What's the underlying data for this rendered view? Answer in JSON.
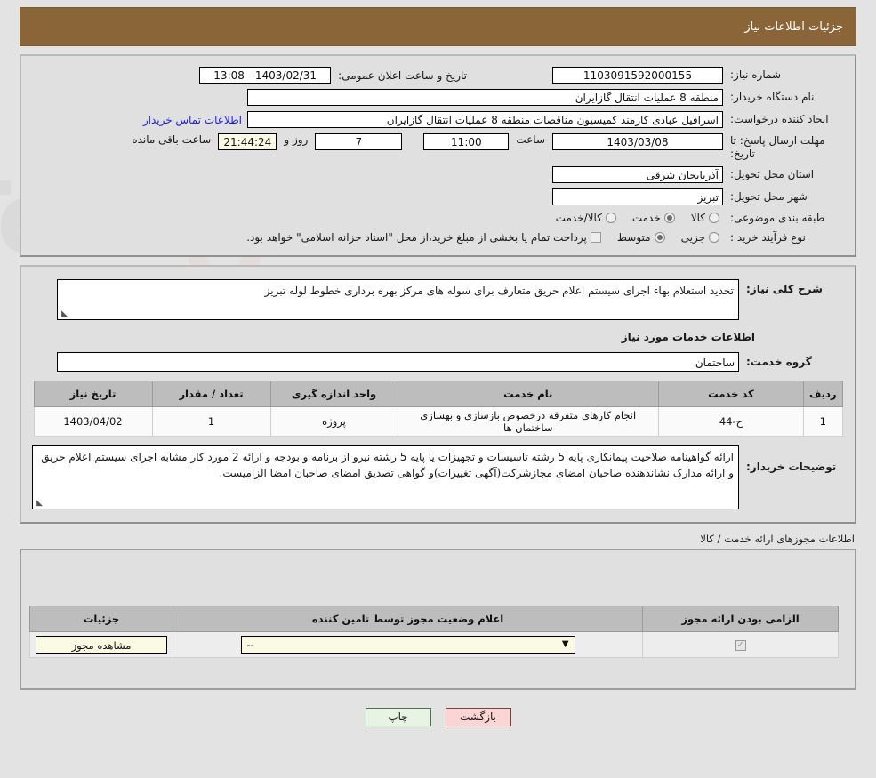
{
  "header": {
    "title": "جزئیات اطلاعات نیاز"
  },
  "fields": {
    "need_number_label": "شماره نیاز:",
    "need_number_value": "1103091592000155",
    "public_announce_label": "تاریخ و ساعت اعلان عمومی:",
    "public_announce_value": "1403/02/31 - 13:08",
    "buyer_org_label": "نام دستگاه خریدار:",
    "buyer_org_value": "منطقه 8 عملیات انتقال گازایران",
    "creator_label": "ایجاد کننده درخواست:",
    "creator_value": "اسرافیل عبادی کارمند کمیسیون مناقصات منطقه 8 عملیات انتقال گازایران",
    "contact_link": "اطلاعات تماس خریدار",
    "deadline_label": "مهلت ارسال پاسخ: تا تاریخ:",
    "deadline_date": "1403/03/08",
    "hour_label": "ساعت",
    "deadline_time": "11:00",
    "days_value": "7",
    "days_label": "روز و",
    "countdown_value": "21:44:24",
    "countdown_label": "ساعت باقی مانده",
    "province_label": "استان محل تحویل:",
    "province_value": "آذربایجان شرقی",
    "city_label": "شهر محل تحویل:",
    "city_value": "تبریز",
    "category_label": "طبقه بندی موضوعی:",
    "category_options": [
      {
        "label": "کالا",
        "selected": false
      },
      {
        "label": "خدمت",
        "selected": true
      },
      {
        "label": "کالا/خدمت",
        "selected": false
      }
    ],
    "process_label": "نوع فرآیند خرید :",
    "process_options": [
      {
        "label": "جزیی",
        "selected": false
      },
      {
        "label": "متوسط",
        "selected": true
      }
    ],
    "treasury_checkbox_label": "پرداخت تمام یا بخشی از مبلغ خرید،از محل \"اسناد خزانه اسلامی\" خواهد بود.",
    "treasury_checked": false
  },
  "description": {
    "label": "شرح کلی نیاز:",
    "value": "تجدید استعلام بهاء  اجرای سیستم اعلام حریق متعارف برای سوله های مرکز بهره برداری خطوط لوله تبریز"
  },
  "services_section": {
    "heading": "اطلاعات خدمات مورد نیاز",
    "service_group_label": "گروه خدمت:",
    "service_group_value": "ساختمان"
  },
  "services_table": {
    "headers": [
      "ردیف",
      "کد خدمت",
      "نام خدمت",
      "واحد اندازه گیری",
      "تعداد / مقدار",
      "تاریخ نیاز"
    ],
    "rows": [
      [
        "1",
        "ح-44",
        "انجام کارهای متفرقه درخصوص بازسازی و بهسازی ساختمان ها",
        "پروژه",
        "1",
        "1403/04/02"
      ]
    ]
  },
  "buyer_notes": {
    "label": "توضیحات خریدار:",
    "value": "ارائه گواهینامه صلاحیت پیمانکاری پایه 5 رشته تاسیسات و تجهیزات یا پایه 5 رشته نیرو  از برنامه و بودجه و ارائه 2 مورد کار مشابه اجرای سیستم اعلام حریق و ارائه مدارک نشاندهنده صاحبان امضای مجازشرکت(آگهی تغییرات)و گواهی تصدیق امضای صاحبان امضا الزامیست."
  },
  "licenses": {
    "outside_label": "اطلاعات مجوزهای ارائه خدمت / کالا",
    "headers": [
      "الزامی بودن ارائه مجوز",
      "اعلام وضعیت مجوز توسط تامین کننده",
      "جزئیات"
    ],
    "row": {
      "required_checked": true,
      "status_value": "--",
      "details_button": "مشاهده مجوز"
    }
  },
  "footer": {
    "back_button": "بازگشت",
    "print_button": "چاپ"
  }
}
